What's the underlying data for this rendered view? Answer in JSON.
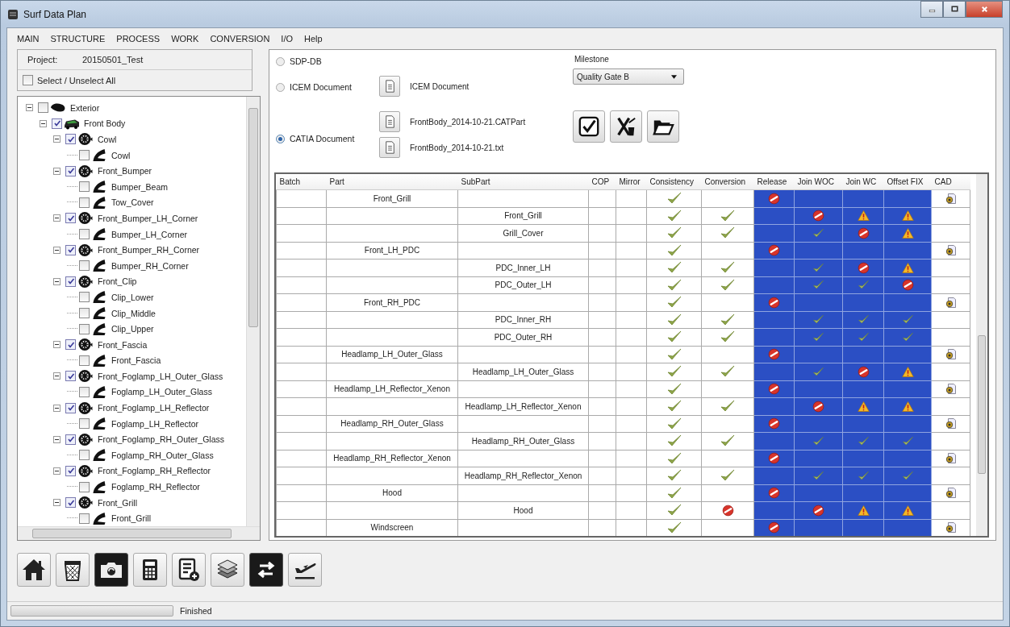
{
  "window": {
    "title": "Surf Data Plan"
  },
  "menu": [
    "MAIN",
    "STRUCTURE",
    "PROCESS",
    "WORK",
    "CONVERSION",
    "I/O",
    "Help"
  ],
  "project": {
    "label": "Project:",
    "value": "20150501_Test"
  },
  "select_all": {
    "label": "Select / Unselect All",
    "checked": false
  },
  "tree": [
    {
      "label": "Exterior",
      "kind": "group",
      "checked": false,
      "expanded": true,
      "children": [
        {
          "label": "Front Body",
          "kind": "assembly",
          "checked": true,
          "expanded": true,
          "children": [
            {
              "label": "Cowl",
              "kind": "part",
              "checked": true,
              "expanded": true,
              "children": [
                {
                  "label": "Cowl",
                  "kind": "surface",
                  "checked": false
                }
              ]
            },
            {
              "label": "Front_Bumper",
              "kind": "part",
              "checked": true,
              "expanded": true,
              "children": [
                {
                  "label": "Bumper_Beam",
                  "kind": "surface",
                  "checked": false
                },
                {
                  "label": "Tow_Cover",
                  "kind": "surface",
                  "checked": false
                }
              ]
            },
            {
              "label": "Front_Bumper_LH_Corner",
              "kind": "part",
              "checked": true,
              "expanded": true,
              "children": [
                {
                  "label": "Bumper_LH_Corner",
                  "kind": "surface",
                  "checked": false
                }
              ]
            },
            {
              "label": "Front_Bumper_RH_Corner",
              "kind": "part",
              "checked": true,
              "expanded": true,
              "children": [
                {
                  "label": "Bumper_RH_Corner",
                  "kind": "surface",
                  "checked": false
                }
              ]
            },
            {
              "label": "Front_Clip",
              "kind": "part",
              "checked": true,
              "expanded": true,
              "children": [
                {
                  "label": "Clip_Lower",
                  "kind": "surface",
                  "checked": false
                },
                {
                  "label": "Clip_Middle",
                  "kind": "surface",
                  "checked": false
                },
                {
                  "label": "Clip_Upper",
                  "kind": "surface",
                  "checked": false
                }
              ]
            },
            {
              "label": "Front_Fascia",
              "kind": "part",
              "checked": true,
              "expanded": true,
              "children": [
                {
                  "label": "Front_Fascia",
                  "kind": "surface",
                  "checked": false
                }
              ]
            },
            {
              "label": "Front_Foglamp_LH_Outer_Glass",
              "kind": "part",
              "checked": true,
              "expanded": true,
              "children": [
                {
                  "label": "Foglamp_LH_Outer_Glass",
                  "kind": "surface",
                  "checked": false
                }
              ]
            },
            {
              "label": "Front_Foglamp_LH_Reflector",
              "kind": "part",
              "checked": true,
              "expanded": true,
              "children": [
                {
                  "label": "Foglamp_LH_Reflector",
                  "kind": "surface",
                  "checked": false
                }
              ]
            },
            {
              "label": "Front_Foglamp_RH_Outer_Glass",
              "kind": "part",
              "checked": true,
              "expanded": true,
              "children": [
                {
                  "label": "Foglamp_RH_Outer_Glass",
                  "kind": "surface",
                  "checked": false
                }
              ]
            },
            {
              "label": "Front_Foglamp_RH_Reflector",
              "kind": "part",
              "checked": true,
              "expanded": true,
              "children": [
                {
                  "label": "Foglamp_RH_Reflector",
                  "kind": "surface",
                  "checked": false
                }
              ]
            },
            {
              "label": "Front_Grill",
              "kind": "part",
              "checked": true,
              "expanded": true,
              "children": [
                {
                  "label": "Front_Grill",
                  "kind": "surface",
                  "checked": false
                }
              ]
            }
          ]
        }
      ]
    }
  ],
  "source": {
    "options": [
      {
        "label": "SDP-DB",
        "selected": false
      },
      {
        "label": "ICEM Document",
        "selected": false
      },
      {
        "label": "CATIA Document",
        "selected": true
      }
    ],
    "icem_file": "ICEM Document",
    "catia_files": [
      "FrontBody_2014-10-21.CATPart",
      "FrontBody_2014-10-21.txt"
    ]
  },
  "milestone": {
    "label": "Milestone",
    "value": "Quality Gate B"
  },
  "table": {
    "columns": [
      "Batch",
      "Part",
      "SubPart",
      "COP",
      "Mirror",
      "Consistency",
      "Conversion",
      "Release",
      "Join WOC",
      "Join WC",
      "Offset FIX",
      "CAD"
    ],
    "rows": [
      {
        "part": "Front_Grill",
        "statuses": [
          {
            "kind": "check"
          },
          {
            "kind": "empty"
          },
          {
            "kind": "prohibited"
          },
          {
            "kind": "empty"
          },
          {
            "kind": "empty"
          },
          {
            "kind": "empty"
          }
        ],
        "cad": true
      },
      {
        "subpart": "Front_Grill",
        "statuses": [
          {
            "kind": "check"
          },
          {
            "kind": "check"
          },
          {
            "kind": "empty"
          },
          {
            "kind": "prohibited"
          },
          {
            "kind": "warning"
          },
          {
            "kind": "warning"
          }
        ],
        "cad": false
      },
      {
        "subpart": "Grill_Cover",
        "statuses": [
          {
            "kind": "check"
          },
          {
            "kind": "check"
          },
          {
            "kind": "empty"
          },
          {
            "kind": "check"
          },
          {
            "kind": "prohibited"
          },
          {
            "kind": "warning"
          }
        ],
        "cad": false
      },
      {
        "part": "Front_LH_PDC",
        "statuses": [
          {
            "kind": "check"
          },
          {
            "kind": "empty"
          },
          {
            "kind": "prohibited"
          },
          {
            "kind": "empty"
          },
          {
            "kind": "empty"
          },
          {
            "kind": "empty"
          }
        ],
        "cad": true
      },
      {
        "subpart": "PDC_Inner_LH",
        "statuses": [
          {
            "kind": "check"
          },
          {
            "kind": "check"
          },
          {
            "kind": "empty"
          },
          {
            "kind": "check"
          },
          {
            "kind": "prohibited"
          },
          {
            "kind": "warning"
          }
        ],
        "cad": false
      },
      {
        "subpart": "PDC_Outer_LH",
        "statuses": [
          {
            "kind": "check"
          },
          {
            "kind": "check"
          },
          {
            "kind": "empty"
          },
          {
            "kind": "check"
          },
          {
            "kind": "check"
          },
          {
            "kind": "prohibited"
          }
        ],
        "cad": false
      },
      {
        "part": "Front_RH_PDC",
        "statuses": [
          {
            "kind": "check"
          },
          {
            "kind": "empty"
          },
          {
            "kind": "prohibited"
          },
          {
            "kind": "empty"
          },
          {
            "kind": "empty"
          },
          {
            "kind": "empty"
          }
        ],
        "cad": true
      },
      {
        "subpart": "PDC_Inner_RH",
        "statuses": [
          {
            "kind": "check"
          },
          {
            "kind": "check"
          },
          {
            "kind": "empty"
          },
          {
            "kind": "check"
          },
          {
            "kind": "check"
          },
          {
            "kind": "check"
          }
        ],
        "cad": false
      },
      {
        "subpart": "PDC_Outer_RH",
        "statuses": [
          {
            "kind": "check"
          },
          {
            "kind": "check"
          },
          {
            "kind": "empty"
          },
          {
            "kind": "check"
          },
          {
            "kind": "check"
          },
          {
            "kind": "check"
          }
        ],
        "cad": false
      },
      {
        "part": "Headlamp_LH_Outer_Glass",
        "statuses": [
          {
            "kind": "check"
          },
          {
            "kind": "empty"
          },
          {
            "kind": "prohibited"
          },
          {
            "kind": "empty"
          },
          {
            "kind": "empty"
          },
          {
            "kind": "empty"
          }
        ],
        "cad": true
      },
      {
        "subpart": "Headlamp_LH_Outer_Glass",
        "statuses": [
          {
            "kind": "check"
          },
          {
            "kind": "check"
          },
          {
            "kind": "empty"
          },
          {
            "kind": "check"
          },
          {
            "kind": "prohibited"
          },
          {
            "kind": "warning"
          }
        ],
        "cad": false
      },
      {
        "part": "Headlamp_LH_Reflector_Xenon",
        "statuses": [
          {
            "kind": "check"
          },
          {
            "kind": "empty"
          },
          {
            "kind": "prohibited"
          },
          {
            "kind": "empty"
          },
          {
            "kind": "empty"
          },
          {
            "kind": "empty"
          }
        ],
        "cad": true
      },
      {
        "subpart": "Headlamp_LH_Reflector_Xenon",
        "statuses": [
          {
            "kind": "check"
          },
          {
            "kind": "check"
          },
          {
            "kind": "empty"
          },
          {
            "kind": "prohibited"
          },
          {
            "kind": "warning"
          },
          {
            "kind": "warning"
          }
        ],
        "cad": false
      },
      {
        "part": "Headlamp_RH_Outer_Glass",
        "statuses": [
          {
            "kind": "check"
          },
          {
            "kind": "empty"
          },
          {
            "kind": "prohibited"
          },
          {
            "kind": "empty"
          },
          {
            "kind": "empty"
          },
          {
            "kind": "empty"
          }
        ],
        "cad": true
      },
      {
        "subpart": "Headlamp_RH_Outer_Glass",
        "statuses": [
          {
            "kind": "check"
          },
          {
            "kind": "check"
          },
          {
            "kind": "empty"
          },
          {
            "kind": "check"
          },
          {
            "kind": "check"
          },
          {
            "kind": "check"
          }
        ],
        "cad": false
      },
      {
        "part": "Headlamp_RH_Reflector_Xenon",
        "statuses": [
          {
            "kind": "check"
          },
          {
            "kind": "empty"
          },
          {
            "kind": "prohibited"
          },
          {
            "kind": "empty"
          },
          {
            "kind": "empty"
          },
          {
            "kind": "empty"
          }
        ],
        "cad": true
      },
      {
        "subpart": "Headlamp_RH_Reflector_Xenon",
        "statuses": [
          {
            "kind": "check"
          },
          {
            "kind": "check"
          },
          {
            "kind": "empty"
          },
          {
            "kind": "check"
          },
          {
            "kind": "check"
          },
          {
            "kind": "check"
          }
        ],
        "cad": false
      },
      {
        "part": "Hood",
        "statuses": [
          {
            "kind": "check"
          },
          {
            "kind": "empty"
          },
          {
            "kind": "prohibited"
          },
          {
            "kind": "empty"
          },
          {
            "kind": "empty"
          },
          {
            "kind": "empty"
          }
        ],
        "cad": true
      },
      {
        "subpart": "Hood",
        "statuses": [
          {
            "kind": "check"
          },
          {
            "kind": "prohibited"
          },
          {
            "kind": "empty"
          },
          {
            "kind": "prohibited"
          },
          {
            "kind": "warning"
          },
          {
            "kind": "warning"
          }
        ],
        "cad": false
      },
      {
        "part": "Windscreen",
        "statuses": [
          {
            "kind": "check"
          },
          {
            "kind": "empty"
          },
          {
            "kind": "prohibited"
          },
          {
            "kind": "empty"
          },
          {
            "kind": "empty"
          },
          {
            "kind": "empty"
          }
        ],
        "cad": true
      }
    ]
  },
  "status_bar": {
    "progress": {
      "level": 0
    },
    "text": "Finished"
  }
}
